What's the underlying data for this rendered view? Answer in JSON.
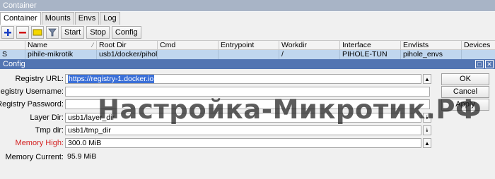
{
  "window": {
    "title": "Container"
  },
  "tabs": [
    {
      "label": "Container",
      "active": true
    },
    {
      "label": "Mounts",
      "active": false
    },
    {
      "label": "Envs",
      "active": false
    },
    {
      "label": "Log",
      "active": false
    }
  ],
  "toolbar": {
    "add_icon": "plus-icon",
    "remove_icon": "minus-icon",
    "comment_icon": "comment-icon",
    "filter_icon": "filter-icon",
    "start_label": "Start",
    "stop_label": "Stop",
    "config_label": "Config"
  },
  "table": {
    "columns": [
      "",
      "Name",
      "Root Dir",
      "Cmd",
      "Entrypoint",
      "Workdir",
      "Interface",
      "Envlists",
      "Devices"
    ],
    "rows": [
      {
        "flag": "S",
        "name": "pihile-mikrotik",
        "root_dir": "usb1/docker/pihol...",
        "cmd": "",
        "entrypoint": "",
        "workdir": "/",
        "interface": "PIHOLE-TUN",
        "envlists": "pihole_envs",
        "devices": ""
      }
    ]
  },
  "dialog": {
    "title": "Config",
    "fields": [
      {
        "label": "Registry URL:",
        "value": "https://registry-1.docker.io",
        "selected": true,
        "control": "up"
      },
      {
        "label": "Registry Username:",
        "value": "",
        "control": "none"
      },
      {
        "label": "Registry Password:",
        "value": "",
        "control": "none"
      },
      {
        "label": "Layer Dir:",
        "value": "usb1/layer_dir",
        "control": "down"
      },
      {
        "label": "Tmp dir:",
        "value": "usb1/tmp_dir",
        "control": "down"
      },
      {
        "label": "Memory High:",
        "value": "300.0 MiB",
        "control": "up",
        "label_color": "#d42020"
      },
      {
        "label": "Memory Current:",
        "value": "95.9 MiB",
        "control": "readonly"
      }
    ],
    "buttons": {
      "ok": "OK",
      "cancel": "Cancel",
      "apply": "Apply"
    }
  },
  "watermark": "Настройка-Микротик.РФ",
  "colors": {
    "title_bar": "#a8b4c6",
    "dialog_title_bar": "#5275b2",
    "selected_row": "#c0d6ee",
    "selection": "#3a6fd8",
    "warning_label": "#d42020"
  }
}
